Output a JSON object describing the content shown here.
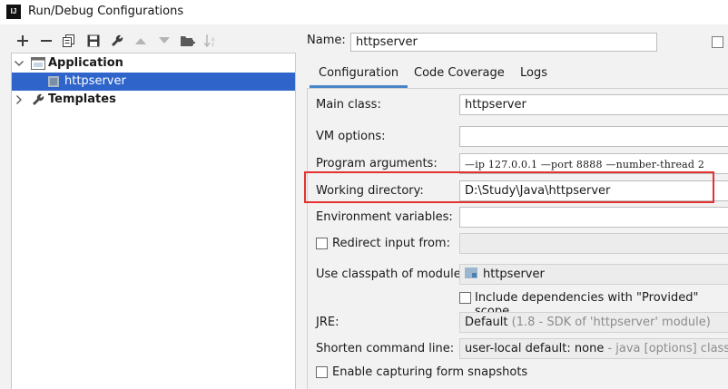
{
  "window": {
    "app_icon_text": "IJ",
    "title": "Run/Debug Configurations"
  },
  "toolbar": {
    "icons": [
      "add-icon",
      "remove-icon",
      "copy-icon",
      "save-icon",
      "wrench-icon",
      "move-up-icon",
      "move-down-icon",
      "folder-add-icon",
      "sort-icon"
    ]
  },
  "tree": {
    "application_label": "Application",
    "child_label": "httpserver",
    "templates_label": "Templates"
  },
  "config": {
    "name_label": "Name:",
    "name_value": "httpserver",
    "tabs": [
      "Configuration",
      "Code Coverage",
      "Logs"
    ],
    "fields": {
      "main_class_label": "Main class:",
      "main_class_value": "httpserver",
      "vm_options_label": "VM options:",
      "vm_options_value": "",
      "program_args_label": "Program arguments:",
      "program_args_value": "—ip 127.0.0.1 —port 8888 —number-thread 2",
      "working_dir_label": "Working directory:",
      "working_dir_value": "D:\\Study\\Java\\httpserver",
      "env_vars_label": "Environment variables:",
      "env_vars_value": "",
      "redirect_input_label": "Redirect input from:",
      "classpath_label": "Use classpath of module:",
      "classpath_value": "httpserver",
      "include_deps_label": "Include dependencies with \"Provided\" scope",
      "jre_label": "JRE:",
      "jre_value": "Default",
      "jre_hint": "(1.8 - SDK of 'httpserver' module)",
      "shorten_label": "Shorten command line:",
      "shorten_value": "user-local default: none",
      "shorten_hint": " - java [options] classname",
      "enable_snapshots_label": "Enable capturing form snapshots"
    }
  },
  "colors": {
    "selection": "#2f65ca",
    "highlight_box": "#e3322f",
    "tab_underline": "#4a86c7"
  }
}
